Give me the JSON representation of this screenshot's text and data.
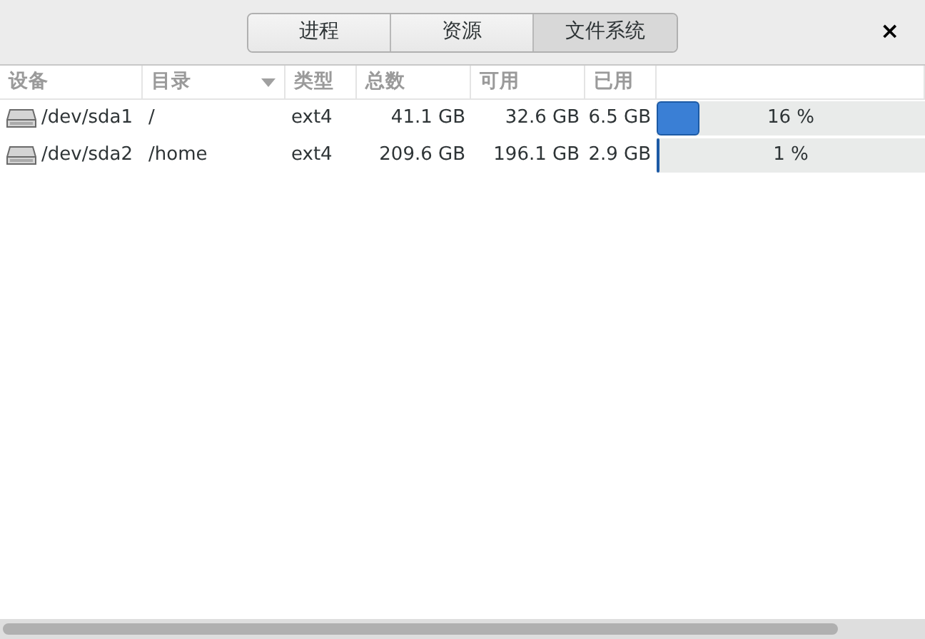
{
  "tabs": [
    {
      "label": "进程",
      "selected": false
    },
    {
      "label": "资源",
      "selected": false
    },
    {
      "label": "文件系统",
      "selected": true
    }
  ],
  "close": "×",
  "table": {
    "columns": [
      {
        "label": "设备",
        "sorted": false
      },
      {
        "label": "目录",
        "sorted": true
      },
      {
        "label": "类型",
        "sorted": false
      },
      {
        "label": "总数",
        "sorted": false
      },
      {
        "label": "可用",
        "sorted": false
      },
      {
        "label": "已用",
        "sorted": false
      }
    ],
    "rows": [
      {
        "device": "/dev/sda1",
        "directory": "/",
        "type": "ext4",
        "total": "41.1 GB",
        "available": "32.6 GB",
        "used": "6.5 GB",
        "level": 0.16,
        "percent": "16 %"
      },
      {
        "device": "/dev/sda2",
        "directory": "/home",
        "type": "ext4",
        "total": "209.6 GB",
        "available": "196.1 GB",
        "used": "2.9 GB",
        "level": 0.01,
        "percent": "1 %"
      }
    ]
  }
}
